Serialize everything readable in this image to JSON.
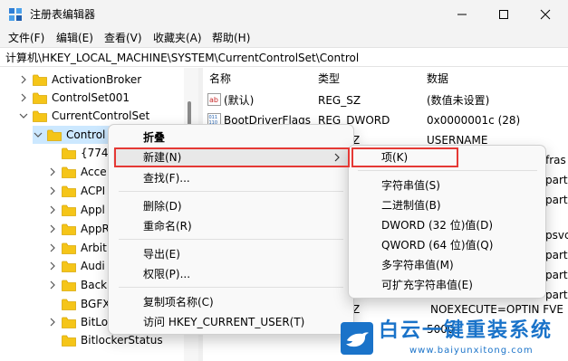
{
  "window": {
    "title": "注册表编辑器",
    "icon": "registry-editor-icon",
    "controls": [
      "minimize-icon",
      "maximize-icon",
      "close-icon"
    ]
  },
  "menubar": {
    "items": [
      "文件(F)",
      "编辑(E)",
      "查看(V)",
      "收藏夹(A)",
      "帮助(H)"
    ]
  },
  "address": "计算机\\HKEY_LOCAL_MACHINE\\SYSTEM\\CurrentControlSet\\Control",
  "tree": {
    "items": [
      {
        "label": "ActivationBroker",
        "expander": "chevron-right"
      },
      {
        "label": "ControlSet001",
        "expander": "chevron-right"
      },
      {
        "label": "CurrentControlSet",
        "expander": "chevron-down"
      },
      {
        "label": "Control",
        "expander": "chevron-down",
        "selected": true
      },
      {
        "label": "{7746",
        "expander": "none"
      },
      {
        "label": "Acce",
        "expander": "chevron-right"
      },
      {
        "label": "ACPI",
        "expander": "chevron-right"
      },
      {
        "label": "Appl",
        "expander": "chevron-right"
      },
      {
        "label": "AppR",
        "expander": "chevron-right"
      },
      {
        "label": "Arbit",
        "expander": "chevron-right"
      },
      {
        "label": "Audi",
        "expander": "chevron-right"
      },
      {
        "label": "Back",
        "expander": "chevron-right"
      },
      {
        "label": "BGFX",
        "expander": "none"
      },
      {
        "label": "BitLo",
        "expander": "chevron-right"
      },
      {
        "label": "BitlockerStatus",
        "expander": "none"
      }
    ]
  },
  "list": {
    "columns": [
      "名称",
      "类型",
      "数据"
    ],
    "rows": [
      {
        "icon": "string-value-icon",
        "name": "(默认)",
        "type": "REG_SZ",
        "data": "(数值未设置)"
      },
      {
        "icon": "binary-value-icon",
        "name": "BootDriverFlags",
        "type": "REG_DWORD",
        "data": "0x0000001c (28)"
      },
      {
        "icon": "",
        "name": "",
        "type": "Z",
        "data": "USERNAME"
      }
    ],
    "data_fragments": [
      "fras",
      "parti",
      "parti",
      "psvc",
      "parti",
      "parti",
      "parti"
    ],
    "partial_row": {
      "type": "Z",
      "data": "NOEXECUTE=OPTIN  FVE"
    },
    "partial_row2": {
      "data": "5000"
    }
  },
  "context_menu": {
    "items": [
      "折叠",
      "新建(N)",
      "查找(F)...",
      "删除(D)",
      "重命名(R)",
      "导出(E)",
      "权限(P)...",
      "复制项名称(C)",
      "访问 HKEY_CURRENT_USER(T)"
    ],
    "submenu_arrow": "chevron-right-icon"
  },
  "submenu": {
    "items": [
      "项(K)",
      "字符串值(S)",
      "二进制值(B)",
      "DWORD (32 位)值(D)",
      "QWORD (64 位)值(Q)",
      "多字符串值(M)",
      "可扩充字符串值(E)"
    ]
  },
  "watermark": {
    "brand": "白云一键重装系统",
    "url": "www.baiyunxitong.com",
    "icon": "bird-logo-icon"
  },
  "colors": {
    "accent_red": "#e53935",
    "selection": "#cce8ff",
    "folder": "#f5c518",
    "watermark_blue": "#1a73c9"
  }
}
